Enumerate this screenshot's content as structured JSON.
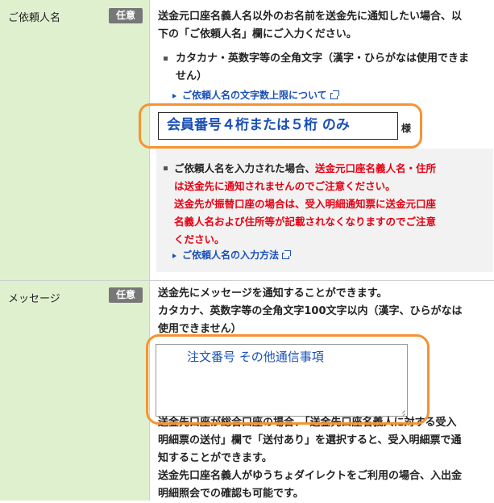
{
  "requester": {
    "label": "ご依頼人名",
    "badge": "任意",
    "desc_line1": "送金元口座名義人名以外のお名前を送金先に通知したい場合、以",
    "desc_line2": "下の「ご依頼人名」欄にご入力ください。",
    "bullet_line1": "カタカナ・英数字等の全角文字（漢字・ひらがなは使用できま",
    "bullet_line2": "せん）",
    "limit_link": "ご依頼人名の文字数上限について",
    "input_value": "会員番号４桁または５桁 のみ",
    "suffix": "様",
    "note_line1_a": "ご依頼人名を入力された場合、",
    "note_line1_b": "送金元口座名義人名・住所",
    "note_line2": "は送金先に通知されませんのでご注意ください。",
    "note_line3": "送金先が振替口座の場合は、受入明細通知票に送金元口座",
    "note_line4": "名義人名および住所等が記載されなくなりますのでご注意",
    "note_line5": "ください。",
    "method_link": "ご依頼人名の入力方法"
  },
  "message": {
    "label": "メッセージ",
    "badge": "任意",
    "desc_line1": "送金先にメッセージを通知することができます。",
    "desc_line2": "カタカナ、英数字等の全角文字100文字以内（漢字、ひらがなは",
    "desc_line3": "使用できません）",
    "textarea_value": "注文番号 その他通信事項",
    "after_line1": "送金先口座が総合口座の場合、「送金先口座名義人に対する受入",
    "after_line2": "明細票の送付」欄で「送付あり」を選択すると、受入明細票で通",
    "after_line3": "知することができます。",
    "after_line4": "送金先口座名義人がゆうちょダイレクトをご利用の場合、入出金",
    "after_line5": "明細照会での確認も可能です。"
  },
  "colors": {
    "label_bg": "#dff0cf",
    "badge_bg": "#777777",
    "link": "#1a4fb8",
    "warning": "#e60012",
    "highlight_oval": "#f79233",
    "note_bg": "#f2f2f2"
  },
  "icons": [
    "bullet-icon",
    "triangle-link-icon",
    "external-window-icon",
    "resize-grip-icon"
  ]
}
